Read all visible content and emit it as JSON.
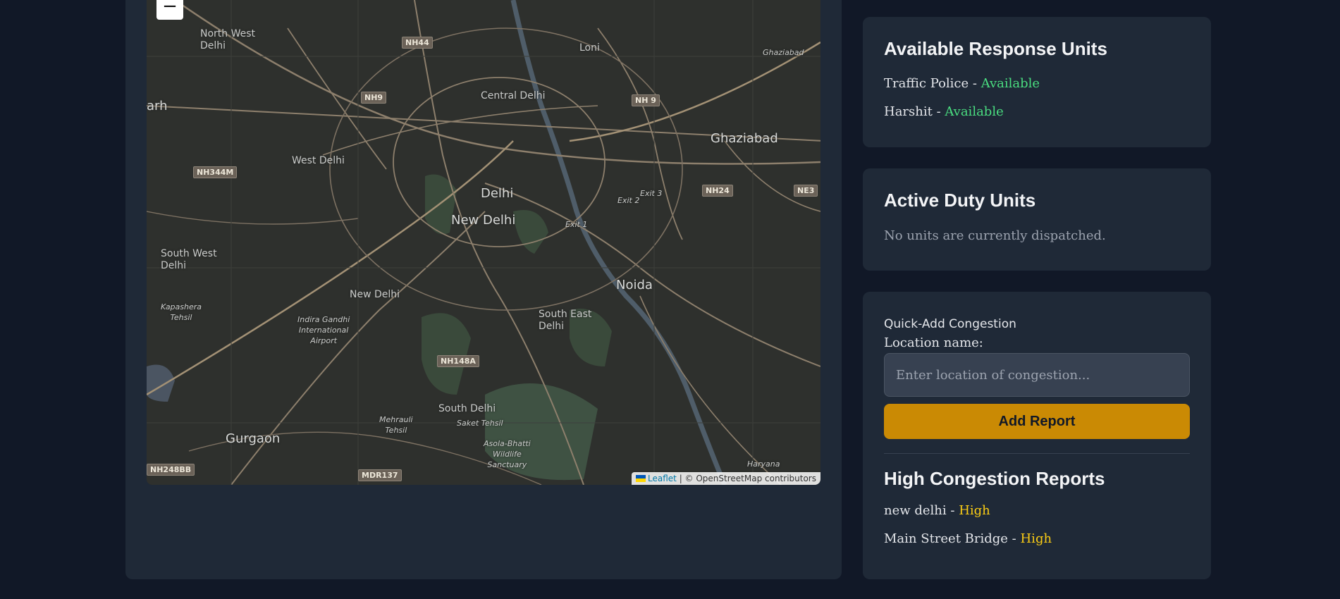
{
  "map": {
    "zoom_out_label": "−",
    "places": [
      {
        "name": "North West\nDelhi"
      },
      {
        "name": "Loni"
      },
      {
        "name": "Ghaziabad"
      },
      {
        "name": "Central Delhi"
      },
      {
        "name": "West Delhi"
      },
      {
        "name": "Delhi"
      },
      {
        "name": "New Delhi"
      },
      {
        "name": "Ghaziabad"
      },
      {
        "name": "South West\nDelhi"
      },
      {
        "name": "New Delhi"
      },
      {
        "name": "Noida"
      },
      {
        "name": "South East\nDelhi"
      },
      {
        "name": "Kapashera\nTehsil"
      },
      {
        "name": "Indira Gandhi\nInternational\nAirport"
      },
      {
        "name": "South Delhi"
      },
      {
        "name": "Saket Tehsil"
      },
      {
        "name": "Mehrauli\nTehsil"
      },
      {
        "name": "Asola-Bhatti\nWildlife\nSanctuary"
      },
      {
        "name": "Gurgaon"
      },
      {
        "name": "Haryana"
      },
      {
        "name": "arh"
      },
      {
        "name": "Exit 3"
      },
      {
        "name": "Exit 2"
      },
      {
        "name": "Exit 1"
      }
    ],
    "shields": [
      "NH44",
      "NH9",
      "NH 9",
      "NH344M",
      "NH24",
      "NE3",
      "NH148A",
      "MDR137",
      "NH248BB"
    ],
    "attribution": {
      "link": "Leaflet",
      "separator": " | ",
      "text": "© OpenStreetMap contributors"
    }
  },
  "available_units": {
    "title": "Available Response Units",
    "items": [
      {
        "name": "Traffic Police",
        "sep": " - ",
        "status": "Available"
      },
      {
        "name": "Harshit",
        "sep": " - ",
        "status": "Available"
      }
    ]
  },
  "active_units": {
    "title": "Active Duty Units",
    "empty_text": "No units are currently dispatched."
  },
  "quick_add": {
    "heading": "Quick-Add Congestion",
    "location_label": "Location name:",
    "placeholder": "Enter location of congestion...",
    "button_label": "Add Report"
  },
  "reports": {
    "title": "High Congestion Reports",
    "items": [
      {
        "location": "new delhi",
        "sep": " - ",
        "level": "High"
      },
      {
        "location": "Main Street Bridge",
        "sep": " - ",
        "level": "High"
      }
    ]
  },
  "colors": {
    "background": "#111827",
    "panel": "#1f2937",
    "available": "#4ade80",
    "high": "#facc15",
    "button": "#ca8a04"
  }
}
